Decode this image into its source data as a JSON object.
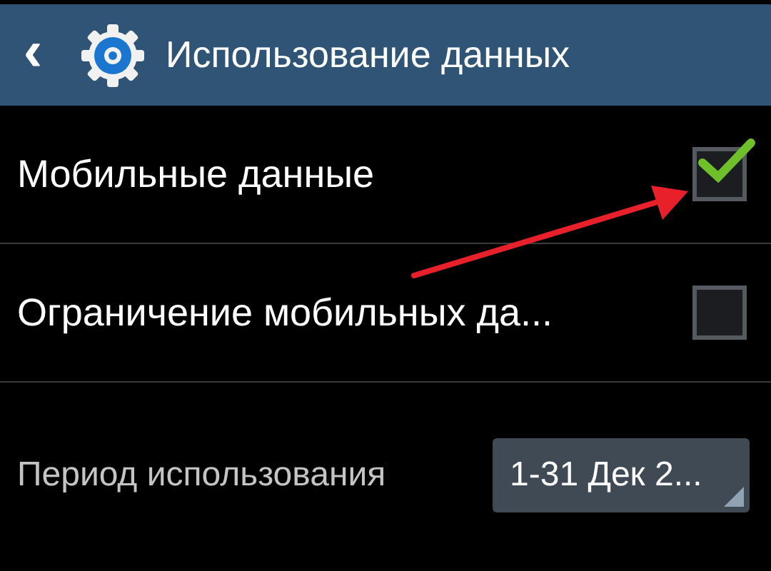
{
  "header": {
    "back": "‹",
    "title": "Использование данных"
  },
  "settings": [
    {
      "label": "Мобильные данные",
      "checked": true
    },
    {
      "label": "Ограничение мобильных да...",
      "checked": false
    }
  ],
  "period": {
    "label": "Период использования",
    "value": "1-31 Дек  2..."
  }
}
